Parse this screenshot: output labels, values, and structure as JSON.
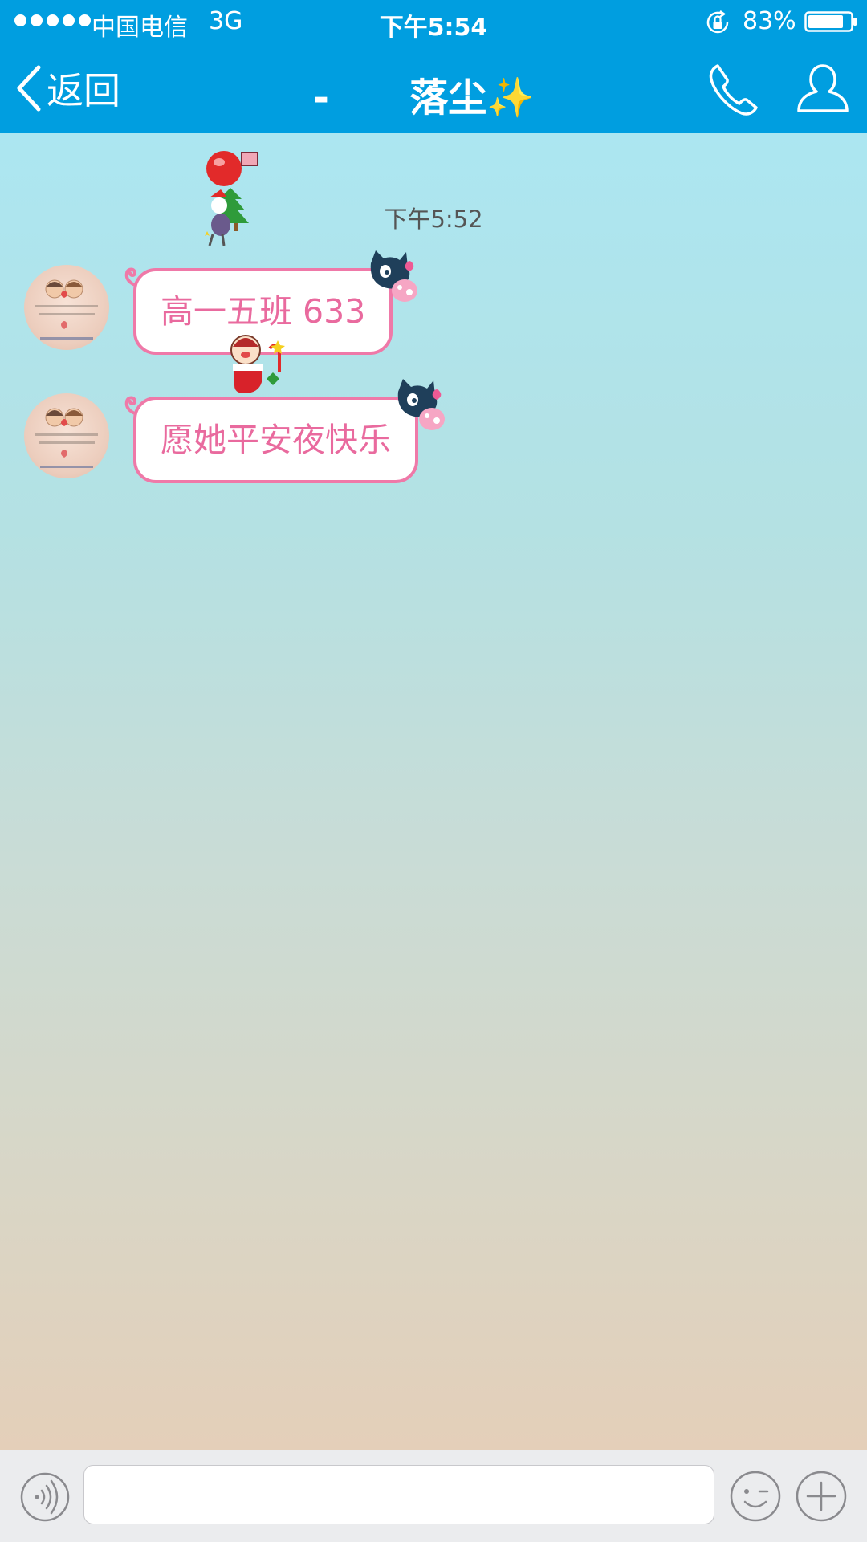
{
  "status_bar": {
    "carrier": "中国电信",
    "network": "3G",
    "time": "下午5:54",
    "battery": "83%",
    "icons": [
      "signal-dots-icon",
      "orientation-lock-icon",
      "battery-icon"
    ]
  },
  "nav": {
    "back_label": "返回",
    "title": "-      落尘✨",
    "icons": [
      "chevron-left-icon",
      "phone-icon",
      "profile-icon"
    ]
  },
  "chat": {
    "timestamp": "下午5:52",
    "messages": [
      {
        "text": "高一五班 633"
      },
      {
        "text": "愿她平安夜快乐"
      }
    ]
  },
  "input_bar": {
    "value": "",
    "placeholder": "",
    "icons": [
      "voice-icon",
      "emoji-icon",
      "plus-icon"
    ]
  },
  "colors": {
    "header": "#009ee0",
    "bubble_border": "#ef79a8",
    "bubble_text": "#e96a9e"
  }
}
